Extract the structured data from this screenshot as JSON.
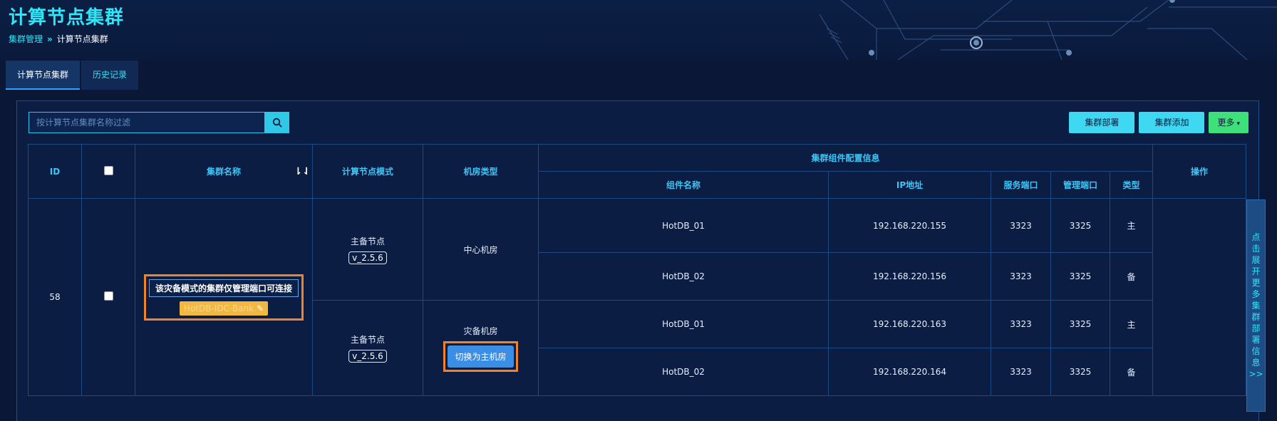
{
  "header": {
    "title": "计算节点集群",
    "breadcrumb": {
      "parent": "集群管理",
      "separator": "»",
      "current": "计算节点集群"
    }
  },
  "tabs": [
    {
      "label": "计算节点集群",
      "active": true
    },
    {
      "label": "历史记录",
      "active": false
    }
  ],
  "search": {
    "placeholder": "按计算节点集群名称过滤",
    "value": "",
    "icon": "search-icon"
  },
  "toolbar": {
    "deploy_label": "集群部署",
    "add_label": "集群添加",
    "more_label": "更多",
    "more_caret": "▾"
  },
  "table": {
    "headers": {
      "id": "ID",
      "name": "集群名称",
      "mode": "计算节点模式",
      "room_type": "机房类型",
      "component_group": "集群组件配置信息",
      "component_name": "组件名称",
      "ip": "IP地址",
      "service_port": "服务端口",
      "manage_port": "管理端口",
      "type": "类型",
      "actions": "操作"
    },
    "sort_icon": "⇂⇃",
    "row": {
      "id": "58",
      "cluster_notice": "该灾备模式的集群仅管理端口可连接",
      "cluster_name": "HotDB-IDC-Bank",
      "edit_icon": "✎",
      "groups": [
        {
          "mode": "主备节点",
          "version": "v_2.5.6",
          "room": "中心机房",
          "components": [
            {
              "name": "HotDB_01",
              "ip": "192.168.220.155",
              "service_port": "3323",
              "manage_port": "3325",
              "type": "主"
            },
            {
              "name": "HotDB_02",
              "ip": "192.168.220.156",
              "service_port": "3323",
              "manage_port": "3325",
              "type": "备"
            }
          ]
        },
        {
          "mode": "主备节点",
          "version": "v_2.5.6",
          "room": "灾备机房",
          "switch_label": "切换为主机房",
          "components": [
            {
              "name": "HotDB_01",
              "ip": "192.168.220.163",
              "service_port": "3323",
              "manage_port": "3325",
              "type": "主"
            },
            {
              "name": "HotDB_02",
              "ip": "192.168.220.164",
              "service_port": "3323",
              "manage_port": "3325",
              "type": "备"
            }
          ]
        }
      ]
    }
  },
  "side_tab": {
    "chars": [
      "点",
      "击",
      "展",
      "开",
      "更",
      "多",
      "集",
      "群",
      "部",
      "署",
      "信",
      "息",
      ">>"
    ]
  },
  "colors": {
    "accent_cyan": "#2ee6f6",
    "highlight_orange": "#f0822a",
    "component_green": "#35e08a",
    "more_green": "#3ee07a",
    "cluster_badge": "#f3b840"
  }
}
